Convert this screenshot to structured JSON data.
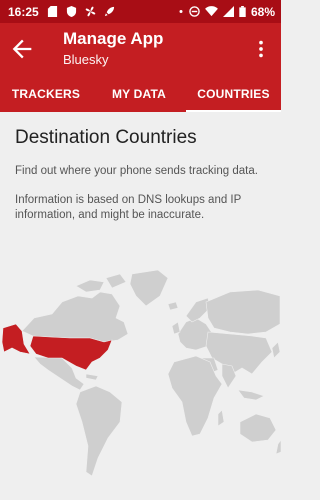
{
  "status_bar": {
    "time": "16:25",
    "battery": "68%",
    "icons": [
      "sd-card-icon",
      "shield-icon",
      "fan-icon",
      "rocket-icon",
      "dot-icon",
      "do-not-disturb-icon",
      "wifi-icon",
      "signal-icon",
      "battery-icon"
    ]
  },
  "app_bar": {
    "title": "Manage App",
    "subtitle": "Bluesky"
  },
  "tabs": [
    {
      "label": "TRACKERS",
      "active": false
    },
    {
      "label": "MY DATA",
      "active": false
    },
    {
      "label": "COUNTRIES",
      "active": true
    }
  ],
  "content": {
    "heading": "Destination Countries",
    "description": "Find out where your phone sends tracking data.",
    "note": "Information is based on DNS lookups and IP information, and might be inaccurate."
  },
  "colors": {
    "brand": "#c41e22",
    "status_bar": "#a80d15",
    "highlight_country": "#c41e22",
    "map_land": "#cfcfcf"
  },
  "map": {
    "highlighted_countries": [
      "United States"
    ]
  }
}
